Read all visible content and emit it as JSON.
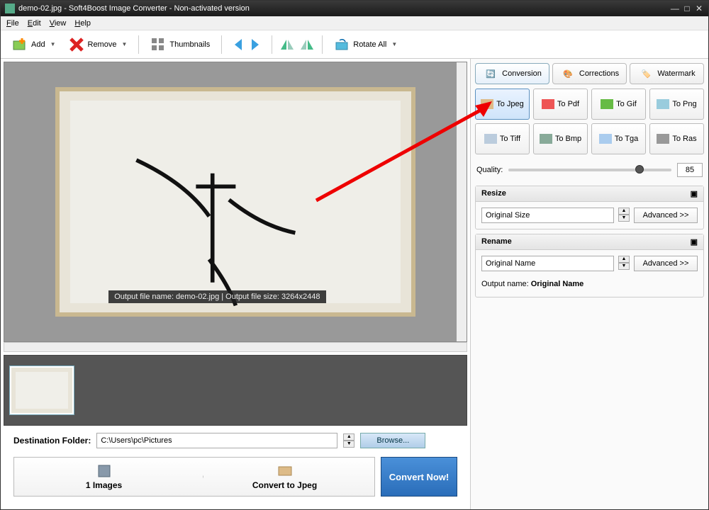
{
  "window": {
    "title": "demo-02.jpg - Soft4Boost Image Converter - Non-activated version"
  },
  "menu": {
    "file": "File",
    "edit": "Edit",
    "view": "View",
    "help": "Help"
  },
  "toolbar": {
    "add": "Add",
    "remove": "Remove",
    "thumbnails": "Thumbnails",
    "rotate_all": "Rotate All"
  },
  "preview": {
    "overlay": "Output file name: demo-02.jpg | Output file size: 3264x2448"
  },
  "dest": {
    "label": "Destination Folder:",
    "path": "C:\\Users\\pc\\Pictures",
    "browse": "Browse..."
  },
  "process": {
    "step1": "1 Images",
    "step2": "Convert to Jpeg",
    "go": "Convert Now!"
  },
  "tabs": {
    "conversion": "Conversion",
    "corrections": "Corrections",
    "watermark": "Watermark"
  },
  "formats": {
    "jpeg": "To Jpeg",
    "pdf": "To Pdf",
    "gif": "To Gif",
    "png": "To Png",
    "tiff": "To Tiff",
    "bmp": "To Bmp",
    "tga": "To Tga",
    "ras": "To Ras"
  },
  "quality": {
    "label": "Quality:",
    "value": "85"
  },
  "resize": {
    "header": "Resize",
    "value": "Original Size",
    "advanced": "Advanced >>"
  },
  "rename": {
    "header": "Rename",
    "value": "Original Name",
    "advanced": "Advanced >>",
    "output_label": "Output name:",
    "output_value": "Original Name"
  }
}
